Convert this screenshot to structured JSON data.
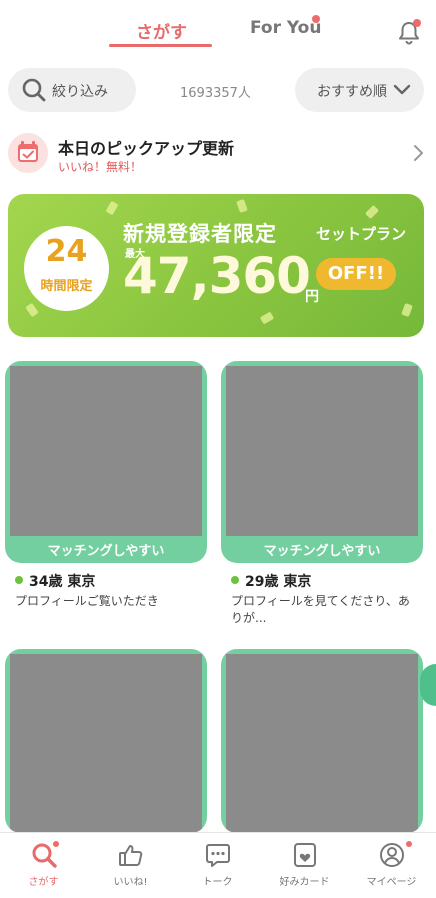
{
  "header": {
    "tabs": [
      {
        "label": "さがす",
        "active": true
      },
      {
        "label": "For You",
        "active": false,
        "badge": true
      }
    ],
    "bell_icon": "bell-icon",
    "accent_color": "#e86a6a"
  },
  "filter": {
    "filter_label": "絞り込み",
    "count_label": "1693357人",
    "sort_label": "おすすめ順"
  },
  "pickup": {
    "title": "本日のピックアップ更新",
    "subtitle": "いいね！無料！"
  },
  "banner": {
    "badge_number": "24",
    "badge_text": "時間限定",
    "title": "新規登録者限定",
    "set_plan": "セットプラン",
    "max_label": "最大",
    "amount": "47,360",
    "yen": "円",
    "off_label": "OFF!!"
  },
  "cards": [
    {
      "chip": "マッチングしやすい",
      "age_loc": "34歳 東京",
      "message": "プロフィールご覧いただき"
    },
    {
      "chip": "マッチングしやすい",
      "age_loc": "29歳 東京",
      "message": "プロフィールを見てくださり、ありが..."
    },
    {
      "chip": "",
      "age_loc": "",
      "message": ""
    },
    {
      "chip": "",
      "age_loc": "",
      "message": ""
    }
  ],
  "bottom_nav": [
    {
      "label": "さがす",
      "icon": "search-icon",
      "active": true
    },
    {
      "label": "いいね!",
      "icon": "thumbs-up-icon",
      "active": false
    },
    {
      "label": "トーク",
      "icon": "chat-icon",
      "active": false
    },
    {
      "label": "好みカード",
      "icon": "favorite-card-icon",
      "active": false
    },
    {
      "label": "マイページ",
      "icon": "profile-icon",
      "active": false
    }
  ]
}
